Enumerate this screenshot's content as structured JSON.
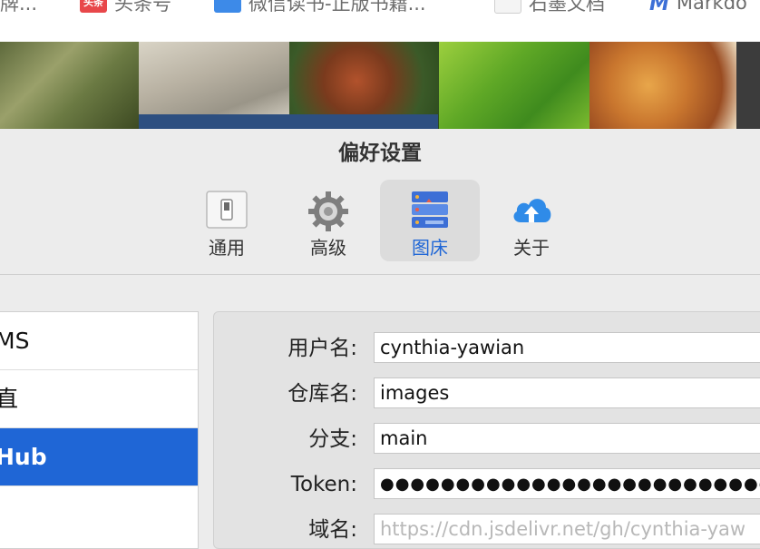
{
  "bookmarks": [
    {
      "label": "牌...",
      "icon": "bookmark-icon"
    },
    {
      "label": "头条号",
      "icon": "toutiao-icon",
      "badge": "头条"
    },
    {
      "label": "微信读书-正版书籍...",
      "icon": "weread-icon"
    },
    {
      "label": "石墨文档",
      "icon": "document-icon"
    },
    {
      "label": "Markdo",
      "icon": "markdown-icon",
      "glyph": "M"
    }
  ],
  "window": {
    "title": "偏好设置"
  },
  "tabs": [
    {
      "label": "通用",
      "icon": "switch-icon",
      "selected": false
    },
    {
      "label": "高级",
      "icon": "gear-icon",
      "selected": false
    },
    {
      "label": "图床",
      "icon": "server-icon",
      "selected": true
    },
    {
      "label": "关于",
      "icon": "cloud-upload-icon",
      "selected": false
    }
  ],
  "services": [
    {
      "label": "MS",
      "selected": false
    },
    {
      "label": "直",
      "selected": false
    },
    {
      "label": "Hub",
      "selected": true
    },
    {
      "label": "",
      "selected": false
    }
  ],
  "form": {
    "username": {
      "label": "用户名:",
      "value": "cynthia-yawian"
    },
    "repo": {
      "label": "仓库名:",
      "value": "images"
    },
    "branch": {
      "label": "分支:",
      "value": "main"
    },
    "token": {
      "label": "Token:",
      "value": "●●●●●●●●●●●●●●●●●●●●●●●●●●●●●●●●●"
    },
    "domain": {
      "label": "域名:",
      "placeholder": "https://cdn.jsdelivr.net/gh/cynthia-yaw"
    }
  },
  "colors": {
    "accent": "#1f66d6",
    "window_bg": "#ececec",
    "panel_bg": "#e3e3e3"
  }
}
